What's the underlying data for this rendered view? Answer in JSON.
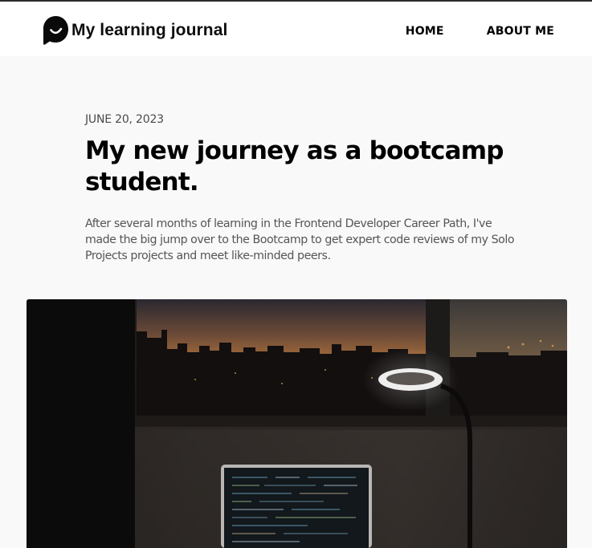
{
  "header": {
    "logo_icon": "speech-bubble-smile-icon",
    "site_title": "My learning journal",
    "nav": [
      {
        "label": "HOME"
      },
      {
        "label": "ABOUT ME"
      }
    ]
  },
  "post": {
    "date": "JUNE 20, 2023",
    "title": "My new journey as a bootcamp student.",
    "summary": "After several months of learning in the Frontend Developer Career Path, I've made the big jump over to the Bootcamp to get expert code reviews of my Solo Projects projects and meet like-minded peers.",
    "hero_image": "laptop-desk-sunset-window-photo"
  },
  "colors": {
    "page_bg": "#f9f9f9",
    "header_bg": "#ffffff",
    "text_primary": "#000000",
    "text_muted": "#555555"
  }
}
